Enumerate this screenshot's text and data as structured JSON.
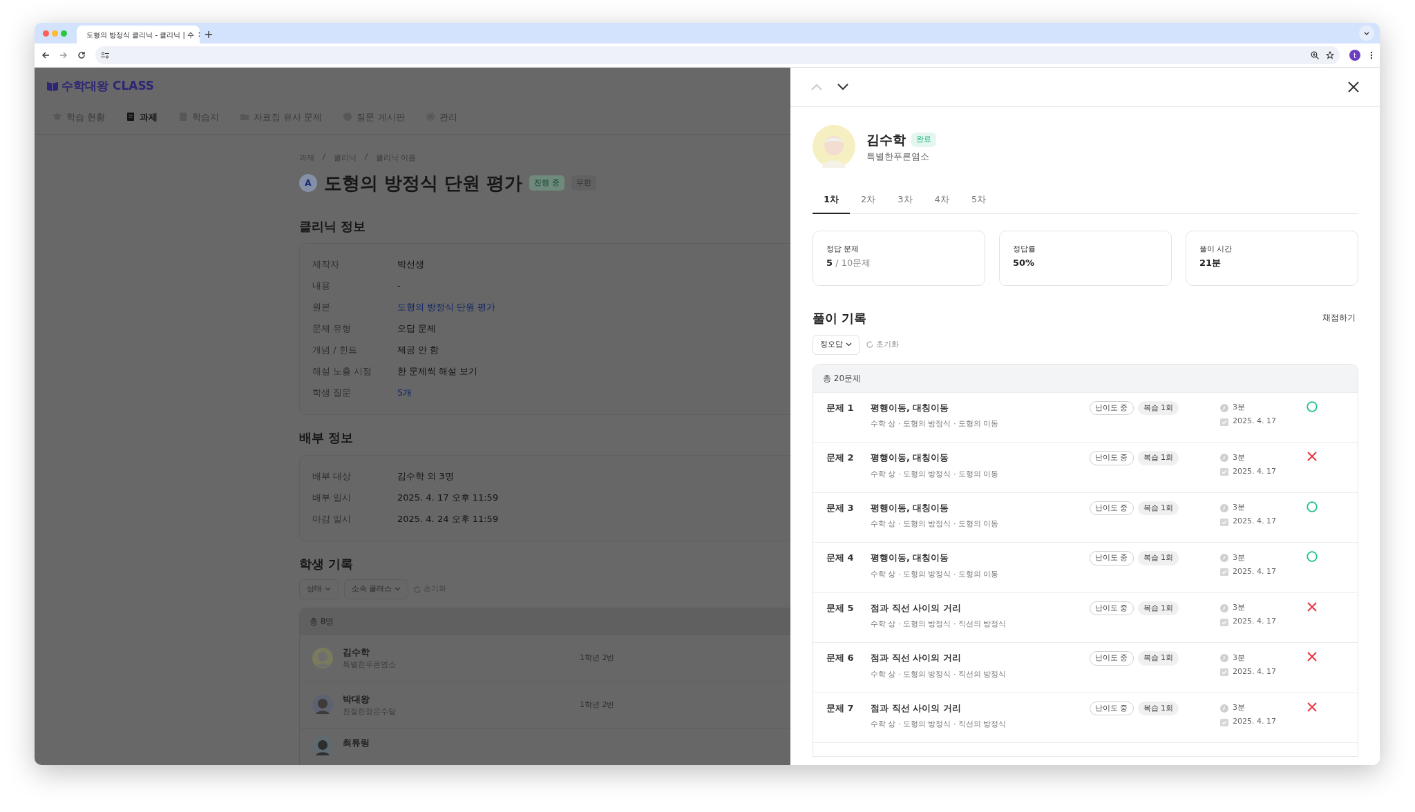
{
  "browser": {
    "tab_title": "도형의 방정식 클리닉 - 클리닉 | 수",
    "profile_letter": "t"
  },
  "app": {
    "logo": "수학대왕 CLASS",
    "nav": [
      {
        "label": "학습 현황",
        "selected": false
      },
      {
        "label": "과제",
        "selected": true
      },
      {
        "label": "학습지",
        "selected": false
      },
      {
        "label": "자료집 유사 문제",
        "selected": false
      },
      {
        "label": "질문 게시판",
        "selected": false
      },
      {
        "label": "관리",
        "selected": false
      }
    ]
  },
  "page": {
    "breadcrumb": [
      "과제",
      "클리닉",
      "클리닉 이름"
    ],
    "title_badge": "A",
    "title": "도형의 방정식 단원 평가",
    "tags": [
      {
        "label": "진행 중",
        "kind": "status"
      },
      {
        "label": "무한",
        "kind": "plain"
      }
    ],
    "clinic_info": {
      "heading": "클리닉 정보",
      "rows": [
        {
          "label": "제작자",
          "value": "박선생",
          "kind": "text"
        },
        {
          "label": "내용",
          "value": "-",
          "kind": "text"
        },
        {
          "label": "원본",
          "value": "도형의 방정식 단원 평가",
          "kind": "link"
        },
        {
          "label": "문제 유형",
          "value": "오답 문제",
          "kind": "text"
        },
        {
          "label": "개념 / 힌트",
          "value": "제공 안 함",
          "kind": "text"
        },
        {
          "label": "해설 노출 시점",
          "value": "한 문제씩 해설 보기",
          "kind": "text"
        },
        {
          "label": "학생 질문",
          "value": "5개",
          "kind": "link"
        }
      ]
    },
    "distribution": {
      "heading": "배부 정보",
      "rows": [
        {
          "label": "배부 대상",
          "value": "김수학 외 3명",
          "kind": "text"
        },
        {
          "label": "배부 일시",
          "value": "2025. 4. 17 오후 11:59",
          "kind": "text"
        },
        {
          "label": "마감 일시",
          "value": "2025. 4. 24 오후 11:59",
          "kind": "text"
        }
      ]
    },
    "students": {
      "heading": "학생 기록",
      "filters": [
        "상태",
        "소속 클래스"
      ],
      "reset": "초기화",
      "total": "총 8명",
      "rows": [
        {
          "name": "김수학",
          "nickname": "특별한푸른염소",
          "class": "1학년 2반"
        },
        {
          "name": "박대왕",
          "nickname": "친절한젊은수달",
          "class": "1학년 2반"
        },
        {
          "name": "최튜링"
        }
      ]
    }
  },
  "panel": {
    "student": {
      "name": "김수학",
      "status": "완료",
      "nickname": "특별한푸른염소"
    },
    "tabs": [
      {
        "label": "1차",
        "selected": true
      },
      {
        "label": "2차",
        "selected": false
      },
      {
        "label": "3차",
        "selected": false
      },
      {
        "label": "4차",
        "selected": false
      },
      {
        "label": "5차",
        "selected": false
      }
    ],
    "stats": [
      {
        "label": "정답 문제",
        "value": "5",
        "total": "/ 10문제"
      },
      {
        "label": "정답률",
        "value": "50%"
      },
      {
        "label": "풀이 시간",
        "value": "21분"
      }
    ],
    "records": {
      "heading": "풀이 기록",
      "grade_button": "채점하기",
      "filter": "정오답",
      "reset": "초기화",
      "total": "총 20문제",
      "problems": [
        {
          "number": "문제 1",
          "title": "평행이동, 대칭이동",
          "path": "수학 상 · 도형의 방정식 · 도형의 이동",
          "difficulty": "난이도 중",
          "review": "복습 1회",
          "time": "3분",
          "date": "2025. 4. 17",
          "correct": true
        },
        {
          "number": "문제 2",
          "title": "평행이동, 대칭이동",
          "path": "수학 상 · 도형의 방정식 · 도형의 이동",
          "difficulty": "난이도 중",
          "review": "복습 1회",
          "time": "3분",
          "date": "2025. 4. 17",
          "correct": false
        },
        {
          "number": "문제 3",
          "title": "평행이동, 대칭이동",
          "path": "수학 상 · 도형의 방정식 · 도형의 이동",
          "difficulty": "난이도 중",
          "review": "복습 1회",
          "time": "3분",
          "date": "2025. 4. 17",
          "correct": true
        },
        {
          "number": "문제 4",
          "title": "평행이동, 대칭이동",
          "path": "수학 상 · 도형의 방정식 · 도형의 이동",
          "difficulty": "난이도 중",
          "review": "복습 1회",
          "time": "3분",
          "date": "2025. 4. 17",
          "correct": true
        },
        {
          "number": "문제 5",
          "title": "점과 직선 사이의 거리",
          "path": "수학 상 · 도형의 방정식 · 직선의 방정식",
          "difficulty": "난이도 중",
          "review": "복습 1회",
          "time": "3분",
          "date": "2025. 4. 17",
          "correct": false
        },
        {
          "number": "문제 6",
          "title": "점과 직선 사이의 거리",
          "path": "수학 상 · 도형의 방정식 · 직선의 방정식",
          "difficulty": "난이도 중",
          "review": "복습 1회",
          "time": "3분",
          "date": "2025. 4. 17",
          "correct": false
        },
        {
          "number": "문제 7",
          "title": "점과 직선 사이의 거리",
          "path": "수학 상 · 도형의 방정식 · 직선의 방정식",
          "difficulty": "난이도 중",
          "review": "복습 1회",
          "time": "3분",
          "date": "2025. 4. 17",
          "correct": false
        }
      ]
    }
  }
}
